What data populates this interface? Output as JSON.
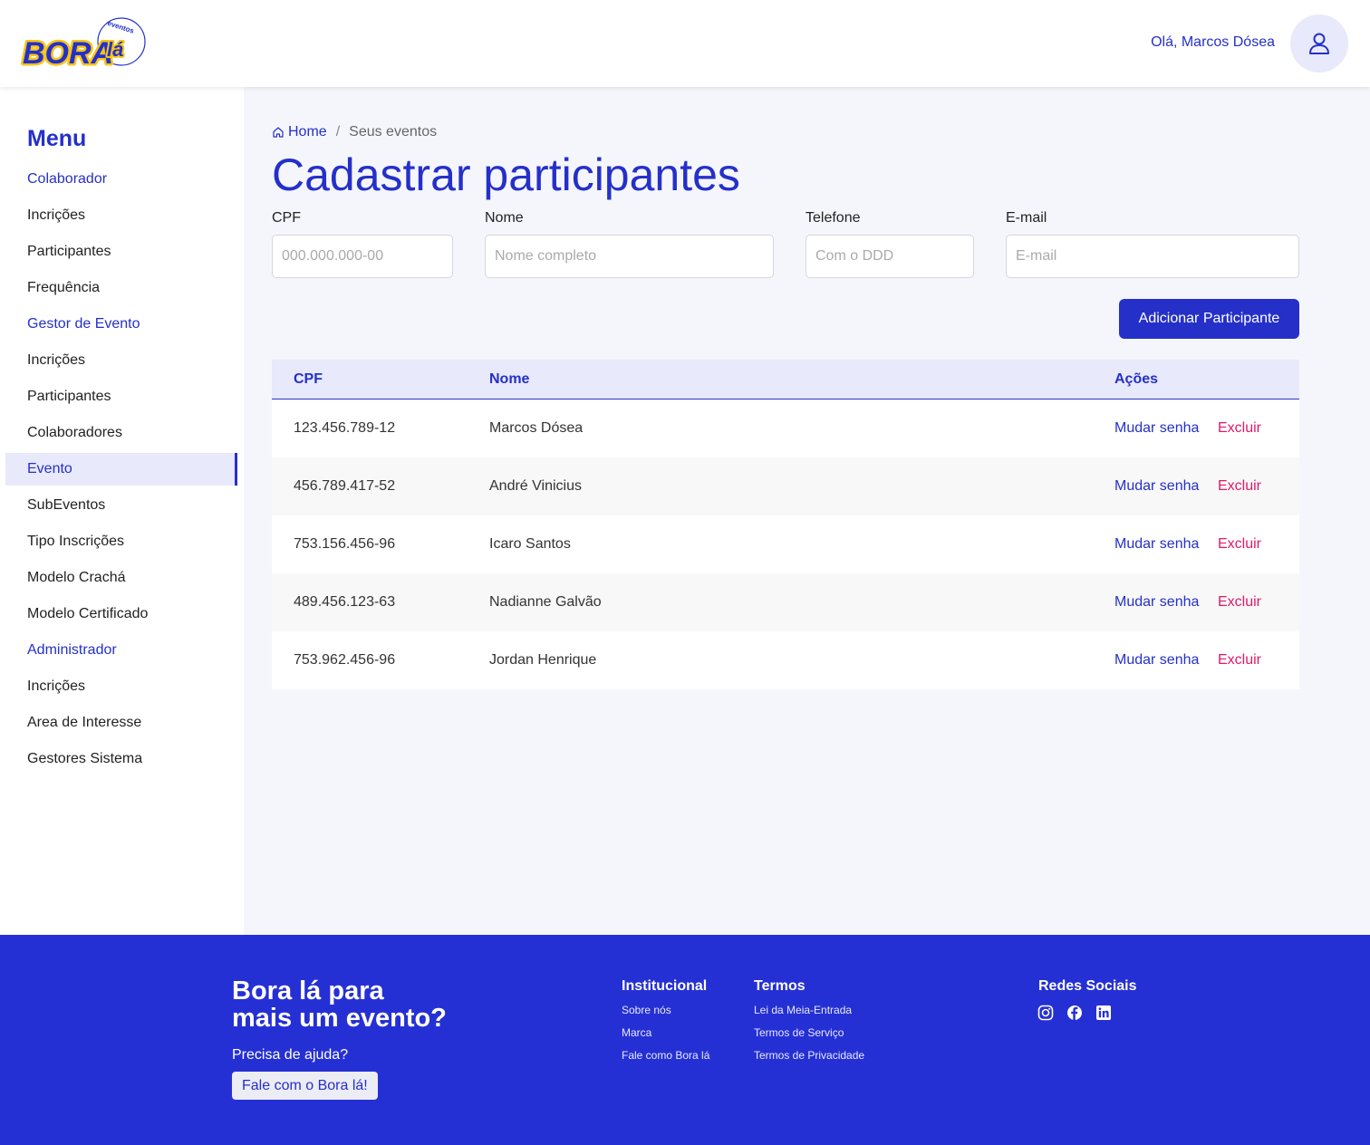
{
  "header": {
    "logo_text": "BORAlá",
    "logo_sub": "eventos",
    "greeting": "Olá, Marcos Dósea"
  },
  "sidebar": {
    "title": "Menu",
    "items": [
      {
        "label": "Colaborador"
      },
      {
        "label": "Incrições"
      },
      {
        "label": "Participantes"
      },
      {
        "label": "Frequência"
      },
      {
        "label": "Gestor de Evento"
      },
      {
        "label": "Incrições"
      },
      {
        "label": "Participantes"
      },
      {
        "label": "Colaboradores"
      },
      {
        "label": "Evento"
      },
      {
        "label": "SubEventos"
      },
      {
        "label": "Tipo Inscrições"
      },
      {
        "label": "Modelo Crachá"
      },
      {
        "label": "Modelo Certificado"
      },
      {
        "label": "Administrador"
      },
      {
        "label": "Incrições"
      },
      {
        "label": "Area de Interesse"
      },
      {
        "label": "Gestores Sistema"
      }
    ]
  },
  "breadcrumb": {
    "home": "Home",
    "separator": "/",
    "current": "Seus eventos"
  },
  "page_title": "Cadastrar participantes",
  "form": {
    "cpf": {
      "label": "CPF",
      "placeholder": "000.000.000-00"
    },
    "nome": {
      "label": "Nome",
      "placeholder": "Nome completo"
    },
    "telefone": {
      "label": "Telefone",
      "placeholder": "Com o DDD"
    },
    "email": {
      "label": "E-mail",
      "placeholder": "E-mail"
    },
    "submit_label": "Adicionar Participante"
  },
  "table": {
    "headers": {
      "cpf": "CPF",
      "nome": "Nome",
      "acoes": "Ações"
    },
    "rows": [
      {
        "cpf": "123.456.789-12",
        "nome": "Marcos Dósea",
        "change": "Mudar senha",
        "delete": "Excluir"
      },
      {
        "cpf": "456.789.417-52",
        "nome": "André Vinicius",
        "change": "Mudar senha",
        "delete": "Excluir"
      },
      {
        "cpf": "753.156.456-96",
        "nome": "Icaro Santos",
        "change": "Mudar senha",
        "delete": "Excluir"
      },
      {
        "cpf": "489.456.123-63",
        "nome": "Nadianne Galvão",
        "change": "Mudar senha",
        "delete": "Excluir"
      },
      {
        "cpf": "753.962.456-96",
        "nome": "Jordan Henrique",
        "change": "Mudar senha",
        "delete": "Excluir"
      }
    ]
  },
  "footer": {
    "tagline_line1": "Bora lá para",
    "tagline_line2": "mais um evento?",
    "help": "Precisa de ajuda?",
    "help_button": "Fale com o Bora lá!",
    "institucional": {
      "title": "Institucional",
      "links": [
        "Sobre nós",
        "Marca",
        "Fale como Bora lá"
      ]
    },
    "termos": {
      "title": "Termos",
      "links": [
        "Lei da Meia-Entrada",
        "Termos de Serviço",
        "Termos de Privacidade"
      ]
    },
    "redes": {
      "title": "Redes Sociais",
      "icons": [
        "instagram-icon",
        "facebook-icon",
        "linkedin-icon"
      ]
    }
  },
  "colors": {
    "primary": "#2530c9",
    "footer_bg": "#2530d4",
    "danger": "#e0196a",
    "logo_yellow": "#f5c518"
  }
}
